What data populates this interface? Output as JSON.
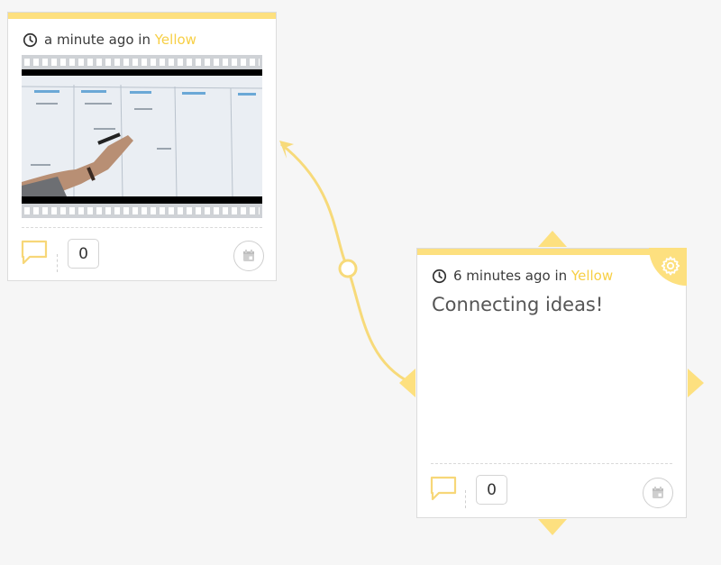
{
  "colors": {
    "accent": "#fde07f",
    "space_text": "#f7cf45",
    "connector": "#f7da7a"
  },
  "card_video": {
    "time": "a minute ago in",
    "space": "Yellow",
    "comment_count": "0",
    "icons": {
      "time": "clock-icon",
      "comment": "speech-bubble-icon",
      "calendar": "calendar-icon"
    }
  },
  "card_note": {
    "time": "6 minutes ago in",
    "space": "Yellow",
    "text": "Connecting ideas!",
    "comment_count": "0",
    "icons": {
      "time": "clock-icon",
      "settings": "gear-icon",
      "comment": "speech-bubble-icon",
      "calendar": "calendar-icon"
    }
  },
  "connector": {
    "ends": "arrowhead-and-circle"
  }
}
